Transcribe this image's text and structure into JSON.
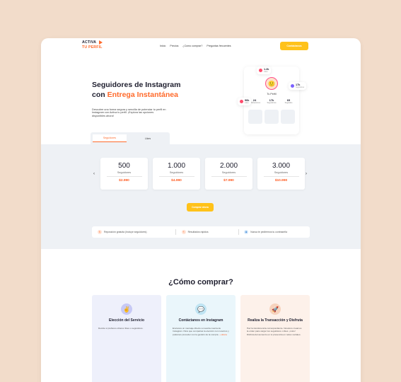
{
  "colors": {
    "accent": "#ff6a2b",
    "cta": "#ffc21a",
    "price": "#ff5a1f",
    "band": "#eef1f5",
    "background": "#f2dcca"
  },
  "header": {
    "logo": {
      "line1": "ACTIVA",
      "line2": "TU PERFIL"
    },
    "nav": [
      "Inicio",
      "Precios",
      "¿Como comprar?",
      "Preguntas frecuentes"
    ],
    "cta_label": "Contáctanos"
  },
  "hero": {
    "title_line1": "Seguidores de Instagram",
    "title_prefix": "con ",
    "title_accent": "Entrega Instantánea",
    "description": "Descubre una forma segura y sencilla de potenciar tu perfil en Instagram con Activa tu perfil. ¡Explora las opciones disponibles ahora!",
    "tabs": [
      "Seguidores",
      "Likes"
    ]
  },
  "profile_card": {
    "name": "Tu Perfil",
    "stats": [
      {
        "value": "24",
        "label": "Publicaciones"
      },
      {
        "value": "17k",
        "label": "Seguidores"
      },
      {
        "value": "69",
        "label": "Seguidos"
      }
    ],
    "bubbles": [
      {
        "value": "1.2k",
        "label": "Likes",
        "icon": "heart-icon"
      },
      {
        "value": "17k",
        "label": "Seguidores",
        "icon": "user-icon"
      },
      {
        "value": "96k",
        "label": "Likes",
        "icon": "heart-icon"
      }
    ]
  },
  "packages": [
    {
      "amount": "500",
      "label": "Seguidores",
      "price": "$2.990"
    },
    {
      "amount": "1.000",
      "label": "Seguidores",
      "price": "$4.990"
    },
    {
      "amount": "2.000",
      "label": "Seguidores",
      "price": "$7.990"
    },
    {
      "amount": "3.000",
      "label": "Seguidores",
      "price": "$10.990"
    }
  ],
  "buy_label": "Comprar ahora",
  "features": [
    {
      "text": "Reposición gratuita (Incluye seguidores)",
      "icon": "refresh-icon"
    },
    {
      "text": "Resultados rápidos",
      "icon": "bolt-icon"
    },
    {
      "text": "Nunca te pediremos tu contraseña",
      "icon": "lock-icon"
    }
  ],
  "how": {
    "title": "¿Cómo comprar?",
    "steps": [
      {
        "title": "Elección del Servicio",
        "desc": "Decide si prefieres obtener likes o seguidores.",
        "link": "",
        "icon": "hand-icon",
        "bg": "#eef0fb",
        "icon_bg": "#c7c9f5"
      },
      {
        "title": "Contáctanos en Instagram",
        "desc": "Envíanos un mensaje directo a nuestra cuenta de Instagram. Para que compartas la elección con nosotros y podamos proceder con la gestión de la compra.",
        "link": "+ ahora",
        "icon": "chat-icon",
        "bg": "#eaf6fb",
        "icon_bg": "#bfe4f3"
      },
      {
        "title": "Realiza la Transacción y Disfruta",
        "desc": "Haz la transferencia correspondiente. Nosotros creamos la orden para cargar tus seguidores o likes. ¡Listo! Disfruta del aumento en tu presencia en redes sociales.",
        "link": "",
        "icon": "rocket-icon",
        "bg": "#fdf1ea",
        "icon_bg": "#f7d3bd"
      }
    ]
  }
}
